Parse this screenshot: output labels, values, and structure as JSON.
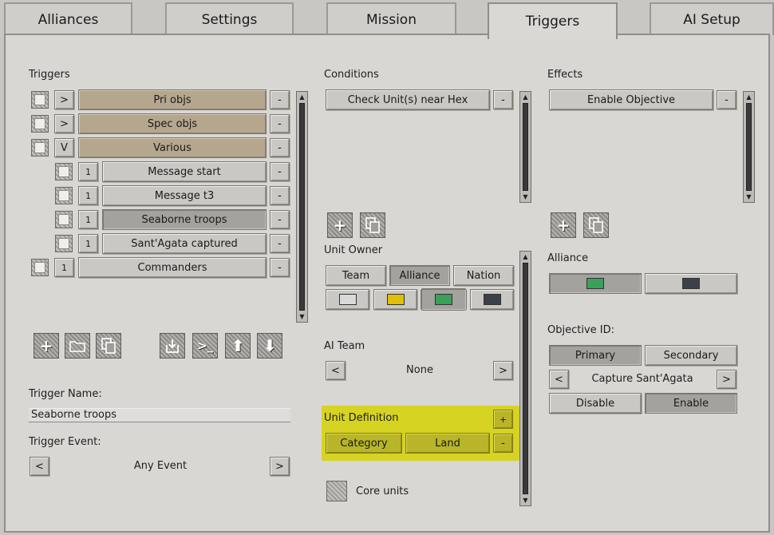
{
  "tabs": [
    {
      "label": "Alliances",
      "active": false
    },
    {
      "label": "Settings",
      "active": false
    },
    {
      "label": "Mission",
      "active": false
    },
    {
      "label": "Triggers",
      "active": true
    },
    {
      "label": "AI Setup",
      "active": false
    }
  ],
  "triggers": {
    "heading": "Triggers",
    "rows": [
      {
        "toggle": ">",
        "label": "Pri objs",
        "remove": "-"
      },
      {
        "toggle": ">",
        "label": "Spec objs",
        "remove": "-"
      },
      {
        "toggle": "V",
        "label": "Various",
        "remove": "-"
      },
      {
        "toggle": "1",
        "label": "Message start",
        "remove": "-"
      },
      {
        "toggle": "1",
        "label": "Message t3",
        "remove": "-"
      },
      {
        "toggle": "1",
        "label": "Seaborne troops",
        "remove": "-"
      },
      {
        "toggle": "1",
        "label": "Sant'Agata captured",
        "remove": "-"
      },
      {
        "toggle": "1",
        "label": "Commanders",
        "remove": "-"
      }
    ],
    "name_label": "Trigger Name:",
    "name_value": "Seaborne troops",
    "event_label": "Trigger Event:",
    "event_value": "Any Event",
    "prev": "<",
    "next": ">"
  },
  "conditions": {
    "heading": "Conditions",
    "item": "Check Unit(s) near Hex",
    "remove": "-",
    "unit_owner_label": "Unit Owner",
    "owner_options": [
      "Team",
      "Alliance",
      "Nation"
    ],
    "owner_selected": "Alliance",
    "team_colors": [
      "#d9d9d9",
      "#e0c000",
      "#3aa05a",
      "#3b4149"
    ],
    "ai_team_label": "AI Team",
    "ai_team_value": "None",
    "prev": "<",
    "next": ">",
    "unit_def_label": "Unit Definition",
    "unit_def_add": "+",
    "unit_def_category": "Category",
    "unit_def_value": "Land",
    "unit_def_remove": "-",
    "core_units_label": "Core units"
  },
  "effects": {
    "heading": "Effects",
    "item": "Enable Objective",
    "remove": "-",
    "alliance_label": "Alliance",
    "alliance_colors": [
      "#3aa05a",
      "#3b4149"
    ],
    "objective_label": "Objective ID:",
    "primary": "Primary",
    "secondary": "Secondary",
    "objective_value": "Capture Sant'Agata",
    "prev": "<",
    "next": ">",
    "disable": "Disable",
    "enable": "Enable"
  }
}
